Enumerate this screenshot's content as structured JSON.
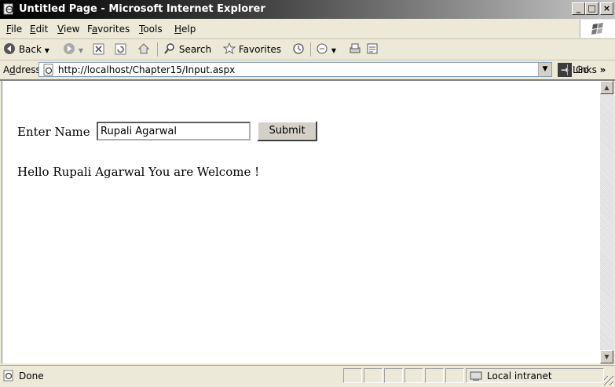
{
  "window": {
    "title": "Untitled Page - Microsoft Internet Explorer",
    "buttons": {
      "minimize": "_",
      "maximize": "□",
      "close": "×"
    }
  },
  "menu": {
    "items": [
      {
        "key": "F",
        "rest": "ile"
      },
      {
        "key": "E",
        "rest": "dit"
      },
      {
        "key": "V",
        "rest": "iew"
      },
      {
        "pre": "F",
        "key": "a",
        "rest": "vorites"
      },
      {
        "key": "T",
        "rest": "ools"
      },
      {
        "key": "H",
        "rest": "elp"
      }
    ]
  },
  "toolbar": {
    "back": "Back",
    "search": "Search",
    "favorites": "Favorites"
  },
  "address": {
    "label_pre": "A",
    "label_key": "d",
    "label_rest": "dress",
    "url": "http://localhost/Chapter15/Input.aspx",
    "go": "Go",
    "links": "Links",
    "links_more": "»"
  },
  "page": {
    "enter_label": "Enter Name",
    "name_value": "Rupali Agarwal",
    "submit": "Submit",
    "message": "Hello Rupali Agarwal You are Welcome !"
  },
  "status": {
    "text": "Done",
    "zone": "Local intranet"
  }
}
